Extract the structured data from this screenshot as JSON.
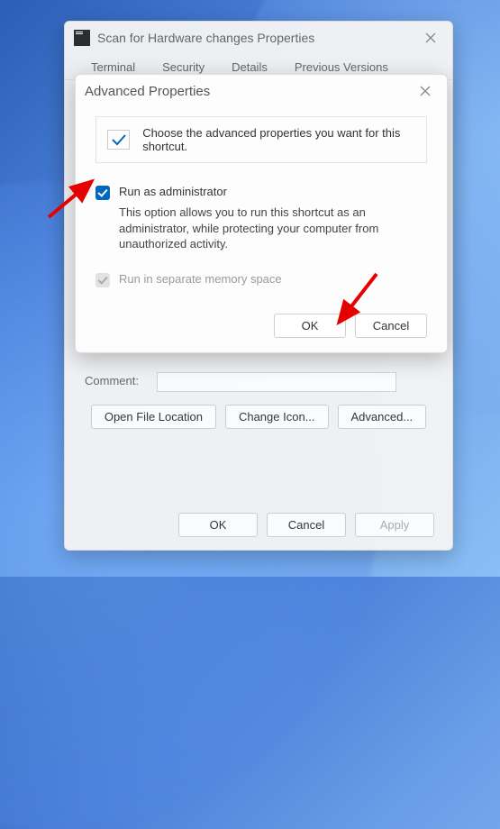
{
  "back_window": {
    "title": "Scan for Hardware changes Properties",
    "tabs": [
      "Terminal",
      "Security",
      "Details",
      "Previous Versions"
    ],
    "comment_label": "Comment:",
    "buttons": {
      "open_location": "Open File Location",
      "change_icon": "Change Icon...",
      "advanced": "Advanced..."
    },
    "footer": {
      "ok": "OK",
      "cancel": "Cancel",
      "apply": "Apply"
    }
  },
  "front_dialog": {
    "title": "Advanced Properties",
    "hint": "Choose the advanced properties you want for this shortcut.",
    "run_admin_label": "Run as administrator",
    "run_admin_desc": "This option allows you to run this shortcut as an administrator, while protecting your computer from unauthorized activity.",
    "separate_mem_label": "Run in separate memory space",
    "buttons": {
      "ok": "OK",
      "cancel": "Cancel"
    }
  }
}
